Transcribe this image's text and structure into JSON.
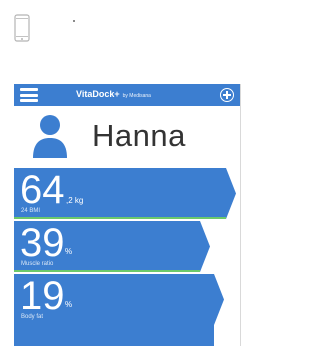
{
  "app": {
    "brand": "VitaDock+",
    "brand_sub": "by Medisana"
  },
  "profile": {
    "name": "Hanna"
  },
  "metrics": [
    {
      "value": "64",
      "unit": ",2 kg",
      "label": "24 BMI"
    },
    {
      "value": "39",
      "unit": "%",
      "label": "Muscle ratio"
    },
    {
      "value": "19",
      "unit": "%",
      "label": "Body fat"
    }
  ],
  "colors": {
    "primary": "#3c7ed0",
    "separator": "#6cc96b"
  },
  "icons": {
    "device": "smartphone-icon",
    "menu": "hamburger-menu-icon",
    "add": "plus-circle-icon",
    "avatar": "person-icon"
  }
}
